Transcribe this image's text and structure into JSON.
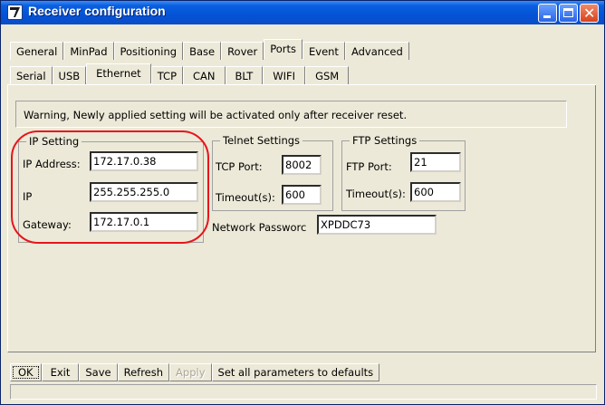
{
  "window": {
    "title": "Receiver configuration",
    "icons": {
      "app": "checkmark-icon",
      "minimize": "minimize-icon",
      "maximize": "maximize-icon",
      "close": "close-icon"
    },
    "close_glyph": "✕"
  },
  "tabs_top": [
    "General",
    "MinPad",
    "Positioning",
    "Base",
    "Rover",
    "Ports",
    "Event",
    "Advanced"
  ],
  "tabs_top_active": "Ports",
  "tabs_sub": [
    "Serial",
    "USB",
    "Ethernet",
    "TCP",
    "CAN",
    "BLT",
    "WIFI",
    "GSM"
  ],
  "tabs_sub_active": "Ethernet",
  "warning": "Warning, Newly applied setting will be activated only after receiver reset.",
  "ip_setting": {
    "legend": "IP Setting",
    "address_label": "IP Address:",
    "address_value": "172.17.0.38",
    "mask_label": "IP",
    "mask_value": "255.255.255.0",
    "gateway_label": "Gateway:",
    "gateway_value": "172.17.0.1"
  },
  "telnet": {
    "legend": "Telnet Settings",
    "port_label": "TCP Port:",
    "port_value": "8002",
    "timeout_label": "Timeout(s):",
    "timeout_value": "600"
  },
  "ftp": {
    "legend": "FTP Settings",
    "port_label": "FTP Port:",
    "port_value": "21",
    "timeout_label": "Timeout(s):",
    "timeout_value": "600"
  },
  "network": {
    "password_label": "Network Passworc",
    "password_value": "XPDDC73"
  },
  "buttons": {
    "ok": "OK",
    "exit": "Exit",
    "save": "Save",
    "refresh": "Refresh",
    "apply": "Apply",
    "defaults": "Set all parameters to defaults"
  },
  "colors": {
    "titlebar": "#0453d6",
    "highlight_ring": "#e8141c",
    "dialog": "#ece9d8"
  }
}
